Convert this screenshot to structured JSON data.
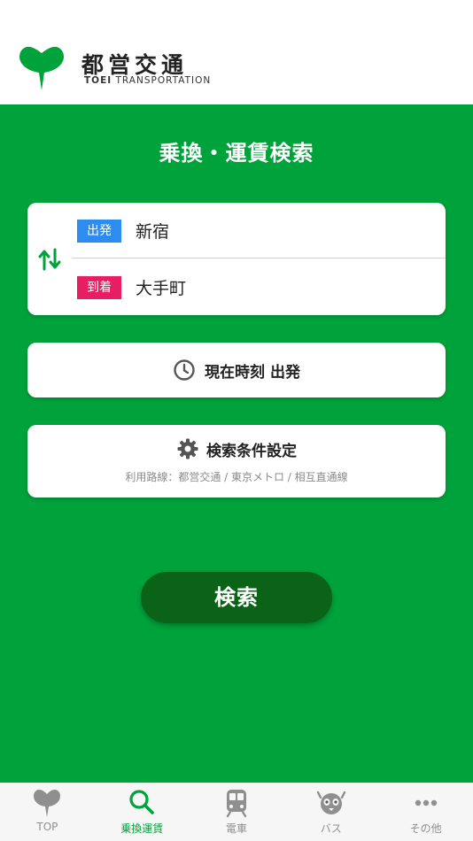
{
  "header": {
    "logo_jp": "都営交通",
    "logo_en_bold": "TOEI",
    "logo_en_rest": " TRANSPORTATION"
  },
  "main": {
    "title": "乗換・運賃検索",
    "departure": {
      "tag": "出発",
      "station": "新宿"
    },
    "arrival": {
      "tag": "到着",
      "station": "大手町"
    },
    "time_label": "現在時刻 出発",
    "conditions": {
      "label": "検索条件設定",
      "sub": "利用路線：都営交通 / 東京メトロ / 相互直通線"
    },
    "search_label": "検索"
  },
  "tabs": [
    {
      "label": "TOP",
      "icon": "ginkgo-icon"
    },
    {
      "label": "乗換運賃",
      "icon": "search-icon",
      "active": true
    },
    {
      "label": "電車",
      "icon": "train-icon"
    },
    {
      "label": "バス",
      "icon": "bus-mascot-icon"
    },
    {
      "label": "その他",
      "icon": "more-icon"
    }
  ],
  "colors": {
    "brand_green": "#00a23b",
    "dark_green": "#0b6317",
    "departure_blue": "#2d8cf0",
    "arrival_pink": "#e81e63"
  }
}
